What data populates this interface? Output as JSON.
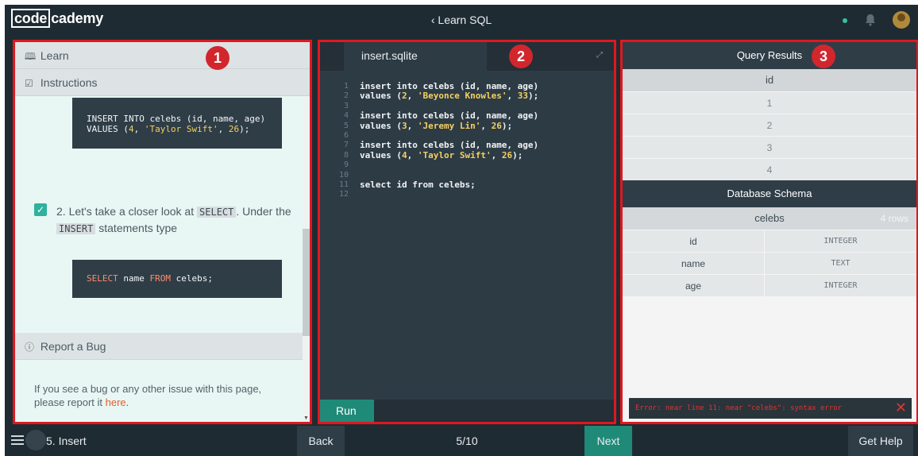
{
  "app": {
    "logo_code": "code",
    "logo_rest": "cademy",
    "course_title": "‹ Learn SQL"
  },
  "colors": {
    "accent_teal": "#1f8a78",
    "highlight_red": "#e0181f",
    "dark_bg": "#1f2b33",
    "error_red": "#e3342f"
  },
  "badges": [
    "1",
    "2",
    "3"
  ],
  "panel1": {
    "learn_label": "Learn",
    "instructions_label": "Instructions",
    "code_top": {
      "line1": "INSERT INTO celebs (id, name, age)",
      "line2_pre": "VALUES (",
      "line2_num": "4",
      "line2_mid": ", ",
      "line2_str": "'Taylor Swift'",
      "line2_mid2": ", ",
      "line2_num2": "26",
      "line2_post": ");"
    },
    "step_number": "2.",
    "step_text_1": "Let's take a closer look at",
    "step_code_1": "SELECT",
    "step_text_2": ". Under the",
    "step_code_2": "INSERT",
    "step_text_3": "statements type",
    "code_select": {
      "kw1": "SELECT",
      "mid": " name ",
      "kw2": "FROM",
      "post": " celebs;"
    },
    "report_label": "Report a Bug",
    "bug_text": "If you see a bug or any other issue with this page, please report it ",
    "bug_link": "here",
    "bug_end": "."
  },
  "panel2": {
    "tab_label": "insert.sqlite",
    "line_numbers": [
      "1",
      "2",
      "3",
      "4",
      "5",
      "6",
      "7",
      "8",
      "9",
      "10",
      "11",
      "12"
    ],
    "code_lines": [
      {
        "t": "insert into celebs (id, name, age)"
      },
      {
        "pre": "values (",
        "n1": "2",
        "m": ", ",
        "s": "'Beyonce Knowles'",
        "m2": ", ",
        "n2": "33",
        "post": ");"
      },
      {
        "t": ""
      },
      {
        "t": "insert into celebs (id, name, age)"
      },
      {
        "pre": "values (",
        "n1": "3",
        "m": ", ",
        "s": "'Jeremy Lin'",
        "m2": ", ",
        "n2": "26",
        "post": ");"
      },
      {
        "t": ""
      },
      {
        "t": "insert into celebs (id, name, age)"
      },
      {
        "pre": "values (",
        "n1": "4",
        "m": ", ",
        "s": "'Taylor Swift'",
        "m2": ", ",
        "n2": "26",
        "post": ");"
      },
      {
        "t": ""
      },
      {
        "t": ""
      },
      {
        "t": "select id from celebs;"
      },
      {
        "t": ""
      }
    ],
    "run_label": "Run"
  },
  "panel3": {
    "results_title": "Query Results",
    "results_column": "id",
    "results_rows": [
      "1",
      "2",
      "3",
      "4"
    ],
    "schema_title": "Database Schema",
    "table_name": "celebs",
    "table_count": "4 rows",
    "schema_rows": [
      {
        "name": "id",
        "type": "INTEGER"
      },
      {
        "name": "name",
        "type": "TEXT"
      },
      {
        "name": "age",
        "type": "INTEGER"
      }
    ],
    "error_text": "Error: near line 11: near \"celebs\": syntax error",
    "error_close": "✕"
  },
  "bottom": {
    "lesson_label": "5. Insert",
    "back_label": "Back",
    "page_count": "5/10",
    "next_label": "Next",
    "help_label": "Get Help"
  }
}
